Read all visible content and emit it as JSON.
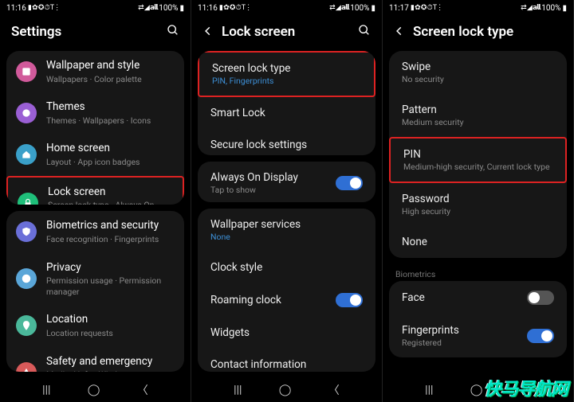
{
  "status": {
    "left1": "11:16",
    "left2": "11:16",
    "left3": "11:17",
    "icons_left": "▮ ✿ ✪ ⏱ T⋮",
    "icons_right": "⇄ ◢ 𝗮𝗹𝗹",
    "battery": "100%"
  },
  "screen1": {
    "title": "Settings",
    "items": [
      {
        "label": "Wallpaper and style",
        "sub": "Wallpapers · Color palette",
        "color": "#d15a9b",
        "icon": "wallpaper"
      },
      {
        "label": "Themes",
        "sub": "Themes · Wallpapers · Icons",
        "color": "#9a5fd4",
        "icon": "themes"
      },
      {
        "label": "Home screen",
        "sub": "Layout · App icon badges",
        "color": "#3aa0c9",
        "icon": "home"
      },
      {
        "label": "Lock screen",
        "sub": "Screen lock type · Always On Display",
        "color": "#1fbf7a",
        "icon": "lock",
        "highlight": true
      },
      {
        "label": "Biometrics and security",
        "sub": "Face recognition · Fingerprints",
        "color": "#6a6fd8",
        "icon": "shield"
      },
      {
        "label": "Privacy",
        "sub": "Permission usage · Permission manager",
        "color": "#5aa6d8",
        "icon": "privacy"
      },
      {
        "label": "Location",
        "sub": "Location requests",
        "color": "#4ab89a",
        "icon": "location"
      },
      {
        "label": "Safety and emergency",
        "sub": "Medical info · Wireless emergency alerts",
        "color": "#d85a5a",
        "icon": "emergency"
      }
    ]
  },
  "screen2": {
    "title": "Lock screen",
    "groups": [
      [
        {
          "label": "Screen lock type",
          "sub": "PIN, Fingerprints",
          "sub_accent": true,
          "highlight": true
        },
        {
          "label": "Smart Lock"
        },
        {
          "label": "Secure lock settings"
        }
      ],
      [
        {
          "label": "Always On Display",
          "sub": "Tap to show",
          "toggle": "on"
        }
      ],
      [
        {
          "label": "Wallpaper services",
          "sub": "None",
          "sub_accent": true
        },
        {
          "label": "Clock style"
        },
        {
          "label": "Roaming clock",
          "toggle": "on"
        },
        {
          "label": "Widgets"
        },
        {
          "label": "Contact information"
        }
      ]
    ]
  },
  "screen3": {
    "title": "Screen lock type",
    "groups": [
      [
        {
          "label": "Swipe",
          "sub": "No security"
        },
        {
          "label": "Pattern",
          "sub": "Medium security"
        },
        {
          "label": "PIN",
          "sub": "Medium-high security,",
          "sub_extra": "Current lock type",
          "highlight": true
        },
        {
          "label": "Password",
          "sub": "High security"
        },
        {
          "label": "None"
        }
      ]
    ],
    "biometrics_label": "Biometrics",
    "biometrics": [
      {
        "label": "Face",
        "toggle": "off"
      },
      {
        "label": "Fingerprints",
        "sub": "Registered",
        "toggle": "on"
      }
    ]
  },
  "watermark": "快马导航网"
}
